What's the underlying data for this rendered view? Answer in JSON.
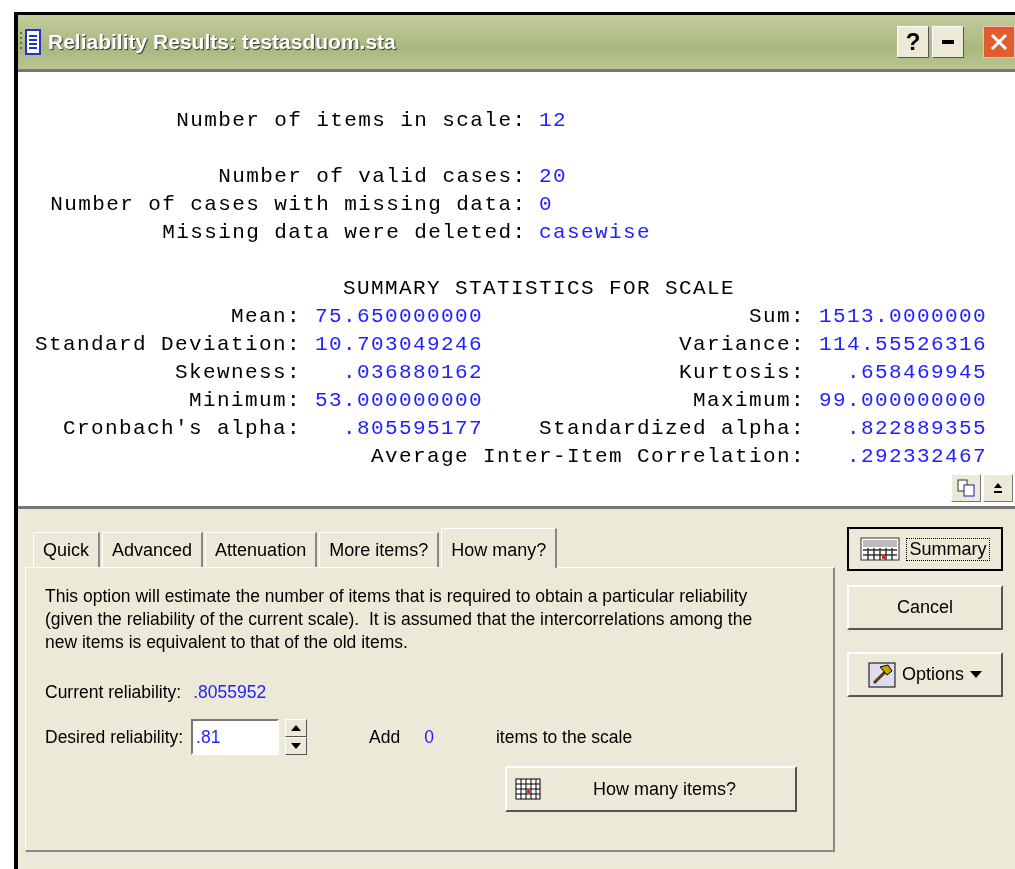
{
  "window": {
    "title": "Reliability Results: testasduom.sta",
    "help_button": "?"
  },
  "report": {
    "info_groups": [
      [
        {
          "label": "Number of items in scale:",
          "value": "12"
        }
      ],
      [
        {
          "label": "Number of valid cases:",
          "value": "20"
        },
        {
          "label": "Number of cases with missing data:",
          "value": "0"
        },
        {
          "label": "Missing data were deleted:",
          "value": "casewise"
        }
      ]
    ],
    "summary_title": "SUMMARY STATISTICS FOR SCALE",
    "summary_rows": [
      {
        "left": {
          "label": "Mean:",
          "value": "75.650000000"
        },
        "right": {
          "label": "Sum:",
          "value": "1513.0000000"
        }
      },
      {
        "left": {
          "label": "Standard Deviation:",
          "value": "10.703049246"
        },
        "right": {
          "label": "Variance:",
          "value": "114.55526316"
        }
      },
      {
        "left": {
          "label": "Skewness:",
          "value": ".036880162"
        },
        "right": {
          "label": "Kurtosis:",
          "value": ".658469945"
        }
      },
      {
        "left": {
          "label": "Minimum:",
          "value": "53.000000000"
        },
        "right": {
          "label": "Maximum:",
          "value": "99.000000000"
        }
      },
      {
        "left": {
          "label": "Cronbach's alpha:",
          "value": ".805595177"
        },
        "right": {
          "label": "Standardized alpha:",
          "value": ".822889355"
        }
      },
      {
        "right": {
          "label": "Average Inter-Item Correlation:",
          "value": ".292332467"
        }
      }
    ]
  },
  "tabs": [
    {
      "label": "Quick",
      "selected": false
    },
    {
      "label": "Advanced",
      "selected": false
    },
    {
      "label": "Attenuation",
      "selected": false
    },
    {
      "label": "More items?",
      "selected": false
    },
    {
      "label": "How many?",
      "selected": true
    }
  ],
  "panel": {
    "description": "This option will estimate the number of items that is required to obtain a particular reliability (given the reliability of the current scale).  It is assumed that the intercorrelations among the new items is equivalent to that of the old items.",
    "current_reliability": {
      "label": "Current reliability:",
      "value": ".8055952"
    },
    "desired_reliability": {
      "label": "Desired reliability:",
      "value": ".81"
    },
    "add_label": "Add",
    "add_value": "0",
    "add_suffix": "items to the scale",
    "action_button": "How many items?"
  },
  "buttons": [
    {
      "label": "Summary",
      "kind": "default"
    },
    {
      "label": "Cancel",
      "kind": "plain"
    },
    {
      "label": "Options",
      "kind": "menu"
    }
  ]
}
